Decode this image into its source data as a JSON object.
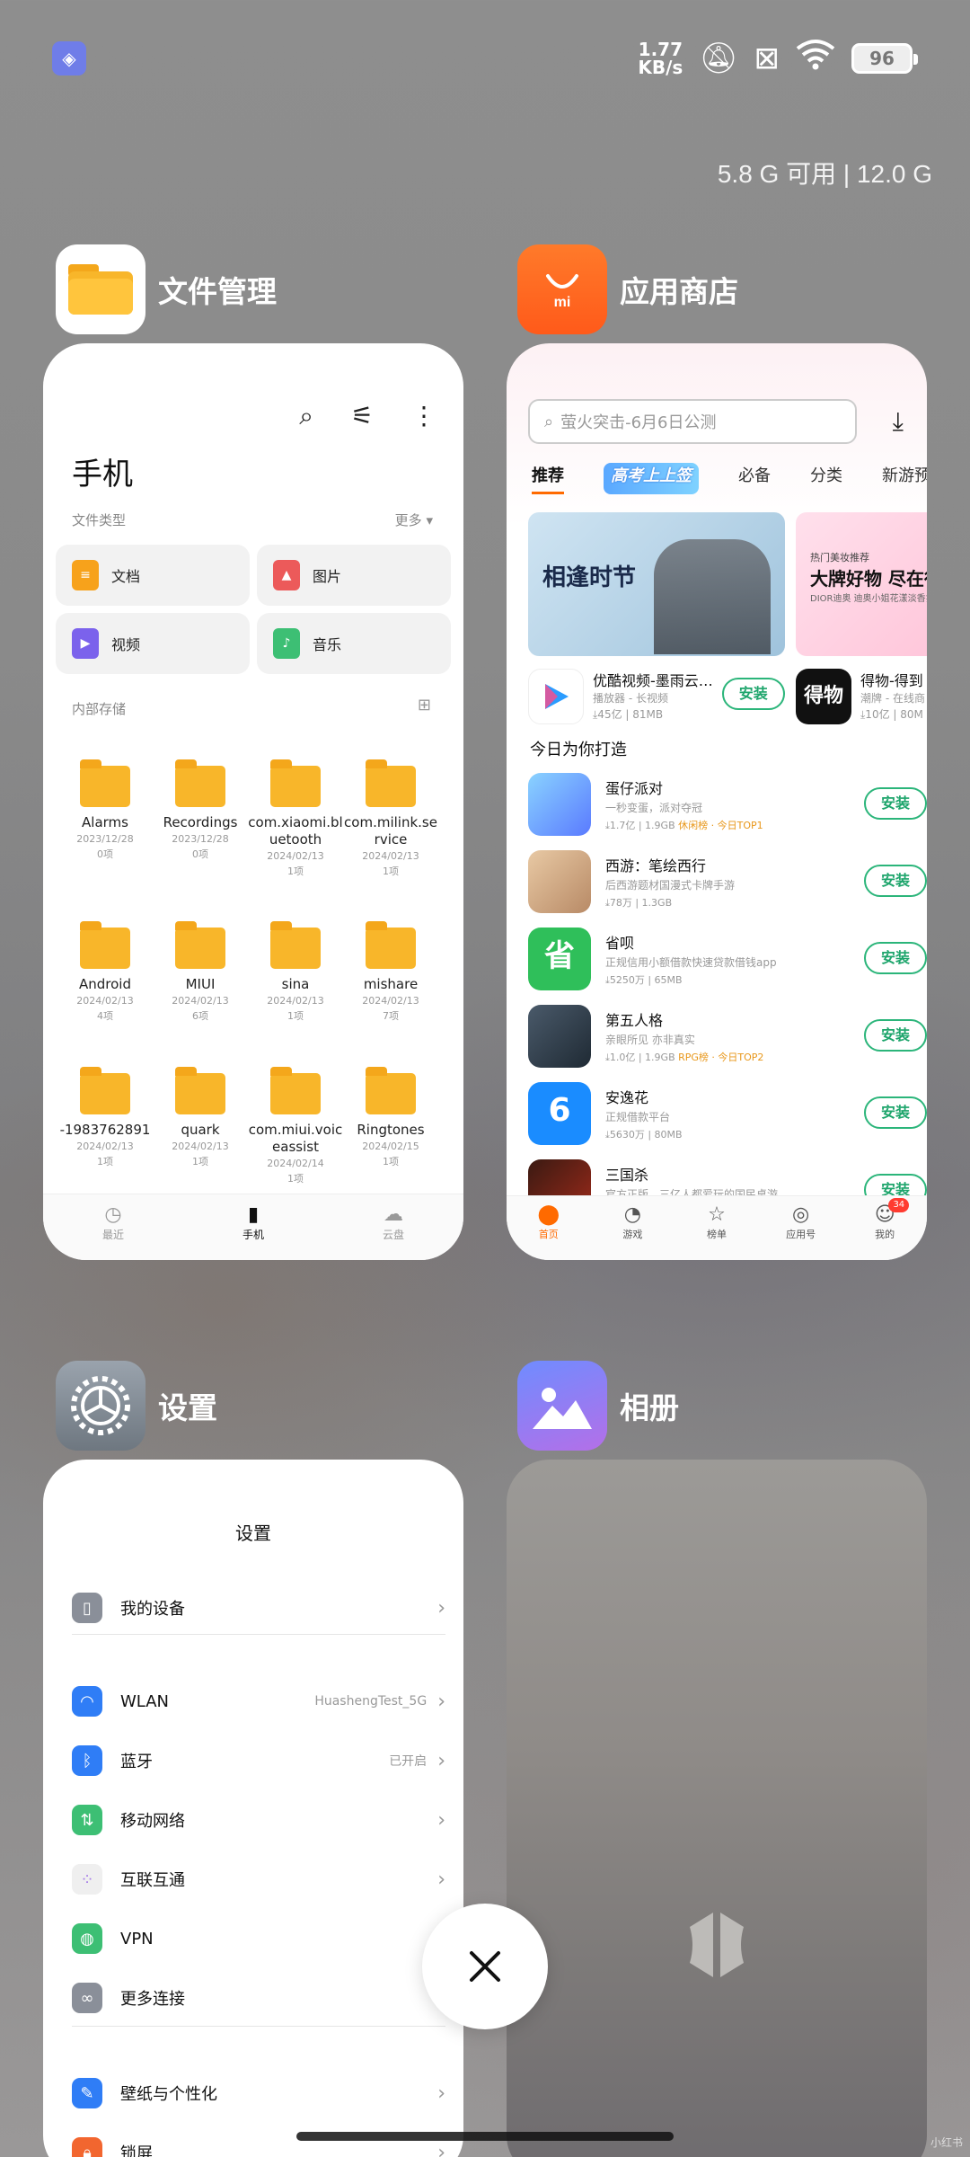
{
  "status": {
    "speed_value": "1.77",
    "speed_unit": "KB/s",
    "battery": "96"
  },
  "memory": "5.8 G 可用 | 12.0 G",
  "apps": {
    "files": {
      "name": "文件管理"
    },
    "store": {
      "name": "应用商店"
    },
    "settings": {
      "name": "设置"
    },
    "album": {
      "name": "相册"
    }
  },
  "files": {
    "title": "手机",
    "types_label": "文件类型",
    "more_label": "更多",
    "categories": [
      {
        "label": "文档",
        "color": "#f7a21b"
      },
      {
        "label": "图片",
        "color": "#ec5a5a"
      },
      {
        "label": "视频",
        "color": "#7b62ec"
      },
      {
        "label": "音乐",
        "color": "#3dbf74"
      }
    ],
    "storage_label": "内部存储",
    "folders": [
      {
        "name": "Alarms",
        "date": "2023/12/28",
        "count": "0项"
      },
      {
        "name": "Recordings",
        "date": "2023/12/28",
        "count": "0项"
      },
      {
        "name": "com.xiaomi.bluetooth",
        "date": "2024/02/13",
        "count": "1项"
      },
      {
        "name": "com.milink.service",
        "date": "2024/02/13",
        "count": "1项"
      },
      {
        "name": "Android",
        "date": "2024/02/13",
        "count": "4项"
      },
      {
        "name": "MIUI",
        "date": "2024/02/13",
        "count": "6项"
      },
      {
        "name": "sina",
        "date": "2024/02/13",
        "count": "1项"
      },
      {
        "name": "mishare",
        "date": "2024/02/13",
        "count": "7项"
      },
      {
        "name": "-1983762891",
        "date": "2024/02/13",
        "count": "1项"
      },
      {
        "name": "quark",
        "date": "2024/02/13",
        "count": "1项"
      },
      {
        "name": "com.miui.voiceassist",
        "date": "2024/02/14",
        "count": "1项"
      },
      {
        "name": "Ringtones",
        "date": "2024/02/15",
        "count": "1项"
      }
    ],
    "nav": [
      "最近",
      "手机",
      "云盘"
    ]
  },
  "store": {
    "search_placeholder": "萤火突击-6月6日公测",
    "tabs": [
      "推荐",
      "高考上上签",
      "必备",
      "分类",
      "新游预约"
    ],
    "banner1_text": "相逢时节",
    "banner2": {
      "small": "热门美妆推荐",
      "big": "大牌好物 尽在得",
      "tiny": "DIOR迪奥 迪奥小姐花漾淡香氛"
    },
    "featured": [
      {
        "name": "优酷视频-墨雨云…",
        "sub": "播放器 - 长视频",
        "meta": "⤓45亿 | 81MB",
        "install": "安装"
      },
      {
        "name": "得物-得到",
        "sub": "潮牌 - 在线商",
        "meta": "⤓10亿 | 80M",
        "install": ""
      }
    ],
    "section": "今日为你打造",
    "list": [
      {
        "name": "蛋仔派对",
        "desc": "一秒变蛋，派对夺冠",
        "meta": "⤓1.7亿 | 1.9GB",
        "tag": "休闲榜 · 今日TOP1",
        "install": "安装"
      },
      {
        "name": "西游：笔绘西行",
        "desc": "后西游题材国漫式卡牌手游",
        "meta": "⤓78万 | 1.3GB",
        "tag": "",
        "install": "安装"
      },
      {
        "name": "省呗",
        "desc": "正规信用小额借款快速贷款借钱app",
        "meta": "⤓5250万 | 65MB",
        "tag": "",
        "install": "安装"
      },
      {
        "name": "第五人格",
        "desc": "亲眼所见 亦非真实",
        "meta": "⤓1.0亿 | 1.9GB",
        "tag": "RPG榜 · 今日TOP2",
        "install": "安装"
      },
      {
        "name": "安逸花",
        "desc": "正规借款平台",
        "meta": "⤓5630万 | 80MB",
        "tag": "",
        "install": "安装"
      },
      {
        "name": "三国杀",
        "desc": "官方正版，三亿人都爱玩的国民桌游",
        "meta": "",
        "tag": "",
        "install": "安装"
      }
    ],
    "nav": [
      "首页",
      "游戏",
      "榜单",
      "应用号",
      "我的"
    ],
    "badge": "34"
  },
  "settings": {
    "title": "设置",
    "rows": [
      {
        "label": "我的设备",
        "value": "",
        "color": "#8a8f99",
        "icon": "phone"
      },
      {
        "label": "WLAN",
        "value": "HuashengTest_5G",
        "color": "#2f7df6",
        "icon": "wifi"
      },
      {
        "label": "蓝牙",
        "value": "已开启",
        "color": "#2f7df6",
        "icon": "bluetooth"
      },
      {
        "label": "移动网络",
        "value": "",
        "color": "#3dbf74",
        "icon": "signal"
      },
      {
        "label": "互联互通",
        "value": "",
        "color": "#efefef",
        "icon": "connect"
      },
      {
        "label": "VPN",
        "value": "",
        "color": "#3dbf74",
        "icon": "globe"
      },
      {
        "label": "更多连接",
        "value": "",
        "color": "#8a8f99",
        "icon": "link"
      },
      {
        "label": "壁纸与个性化",
        "value": "",
        "color": "#2f7df6",
        "icon": "brush"
      },
      {
        "label": "锁屏",
        "value": "",
        "color": "#f2662f",
        "icon": "lock"
      }
    ]
  },
  "watermark": "小红书"
}
